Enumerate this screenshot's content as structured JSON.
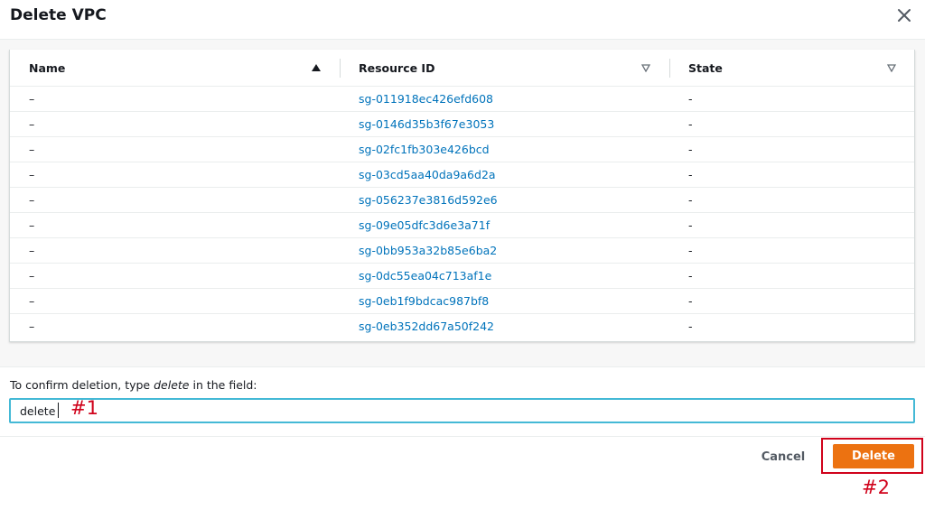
{
  "dialog": {
    "title": "Delete VPC",
    "close_icon": "close-icon"
  },
  "table": {
    "columns": [
      {
        "label": "Name",
        "sort_icon": "sort-ascending-icon"
      },
      {
        "label": "Resource ID",
        "sort_icon": "sort-descending-icon"
      },
      {
        "label": "State",
        "sort_icon": "sort-descending-icon"
      }
    ],
    "rows": [
      {
        "name": "–",
        "resource_id": "sg-011918ec426efd608",
        "state": "-"
      },
      {
        "name": "–",
        "resource_id": "sg-0146d35b3f67e3053",
        "state": "-"
      },
      {
        "name": "–",
        "resource_id": "sg-02fc1fb303e426bcd",
        "state": "-"
      },
      {
        "name": "–",
        "resource_id": "sg-03cd5aa40da9a6d2a",
        "state": "-"
      },
      {
        "name": "–",
        "resource_id": "sg-056237e3816d592e6",
        "state": "-"
      },
      {
        "name": "–",
        "resource_id": "sg-09e05dfc3d6e3a71f",
        "state": "-"
      },
      {
        "name": "–",
        "resource_id": "sg-0bb953a32b85e6ba2",
        "state": "-"
      },
      {
        "name": "–",
        "resource_id": "sg-0dc55ea04c713af1e",
        "state": "-"
      },
      {
        "name": "–",
        "resource_id": "sg-0eb1f9bdcac987bf8",
        "state": "-"
      },
      {
        "name": "–",
        "resource_id": "sg-0eb352dd67a50f242",
        "state": "-"
      }
    ]
  },
  "confirm": {
    "label_prefix": "To confirm deletion, type ",
    "label_keyword": "delete",
    "label_suffix": " in the field:",
    "input_value": "delete"
  },
  "annotations": {
    "marker_1": "#1",
    "marker_2": "#2"
  },
  "footer": {
    "cancel_label": "Cancel",
    "delete_label": "Delete"
  },
  "colors": {
    "link": "#0073bb",
    "primary_button": "#ec7211",
    "input_focus": "#44b9d6",
    "annotation_red": "#d0021b"
  }
}
